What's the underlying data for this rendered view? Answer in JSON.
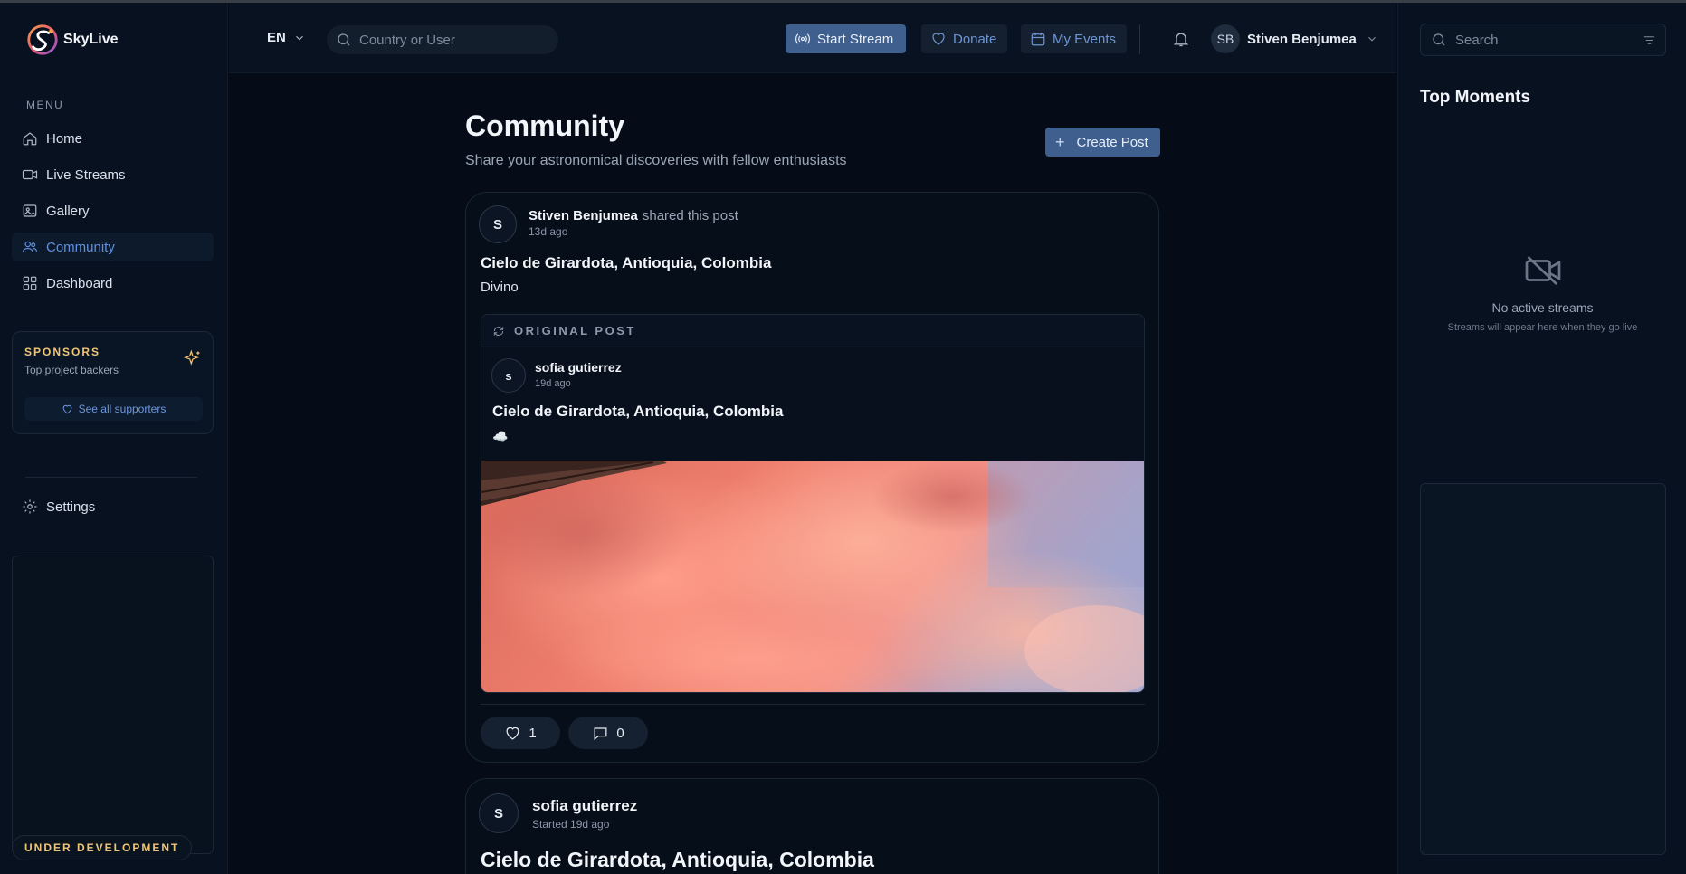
{
  "app": {
    "name": "SkyLive"
  },
  "sidebar": {
    "menu_label": "MENU",
    "items": [
      {
        "label": "Home",
        "icon": "home-icon"
      },
      {
        "label": "Live Streams",
        "icon": "video-icon"
      },
      {
        "label": "Gallery",
        "icon": "image-icon"
      },
      {
        "label": "Community",
        "icon": "users-icon",
        "active": true
      },
      {
        "label": "Dashboard",
        "icon": "grid-icon"
      }
    ],
    "sponsors": {
      "title": "SPONSORS",
      "subtitle": "Top project backers",
      "see_all": "See all supporters"
    },
    "settings_label": "Settings",
    "badge": "UNDER DEVELOPMENT"
  },
  "header": {
    "lang": "EN",
    "search_placeholder": "Country or User",
    "start_stream": "Start Stream",
    "donate": "Donate",
    "my_events": "My Events",
    "user": {
      "initials": "SB",
      "name": "Stiven Benjumea"
    }
  },
  "main": {
    "title": "Community",
    "subtitle": "Share your astronomical discoveries with fellow enthusiasts",
    "create_post": "Create Post",
    "posts": [
      {
        "avatar_initial": "S",
        "author": "Stiven Benjumea",
        "action": "shared this post",
        "time": "13d ago",
        "title": "Cielo de Girardota, Antioquia, Colombia",
        "body": "Divino",
        "original": {
          "label": "ORIGINAL POST",
          "avatar_initial": "s",
          "author": "sofia gutierrez",
          "time": "19d ago",
          "title": "Cielo de Girardota, Antioquia, Colombia",
          "body": "☁️"
        },
        "likes": "1",
        "comments": "0"
      },
      {
        "avatar_initial": "S",
        "author": "sofia gutierrez",
        "time": "Started 19d ago",
        "title": "Cielo de Girardota, Antioquia, Colombia"
      }
    ]
  },
  "right_panel": {
    "search_placeholder": "Search",
    "title": "Top Moments",
    "empty_title": "No active streams",
    "empty_subtitle": "Streams will appear here when they go live"
  },
  "colors": {
    "accent": "#3f5f8f",
    "active_nav": "#5f8fe0",
    "sponsor_gold": "#f0c674"
  }
}
